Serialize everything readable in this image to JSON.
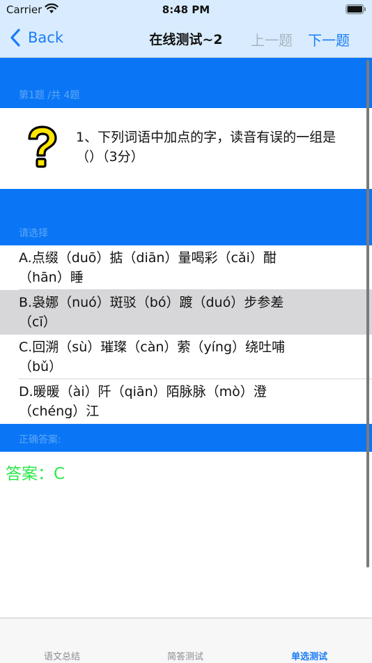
{
  "status_bar": {
    "carrier": "Carrier",
    "time": "8:48 PM"
  },
  "nav": {
    "back_label": "Back",
    "title": "在线测试~2",
    "prev_label": "上一题",
    "next_label": "下一题"
  },
  "question": {
    "progress": "第1题 /共 4题",
    "text": "1、下列词语中加点的字，读音有误的一组是（）（3分）"
  },
  "select_prompt": "请选择",
  "options": [
    {
      "line1": "A.点缀（duō）掂（diān）量喝彩（cǎi）酣",
      "line2": "（hān）睡"
    },
    {
      "line1": "B.袅娜（nuó）斑驳（bó）踱（duó）步参差",
      "line2": "（cī）"
    },
    {
      "line1": "C.回溯（sù）璀璨（càn）萦（yíng）绕吐哺",
      "line2": "（bǔ）"
    },
    {
      "line1": "D.暖暖（ài）阡（qiān）陌脉脉（mò）澄",
      "line2": "（chéng）江"
    }
  ],
  "selected_option": "B",
  "answer_header": "正确答案:",
  "answer_text": "答案：C",
  "tabs": [
    {
      "label": "语文总结"
    },
    {
      "label": "简答测试"
    },
    {
      "label": "单选测试"
    }
  ],
  "active_tab": "单选测试",
  "colors": {
    "accent": "#1a7cf5",
    "band": "#0a76f6",
    "answer": "#2de84b",
    "nav_background": "#d9ecff"
  }
}
